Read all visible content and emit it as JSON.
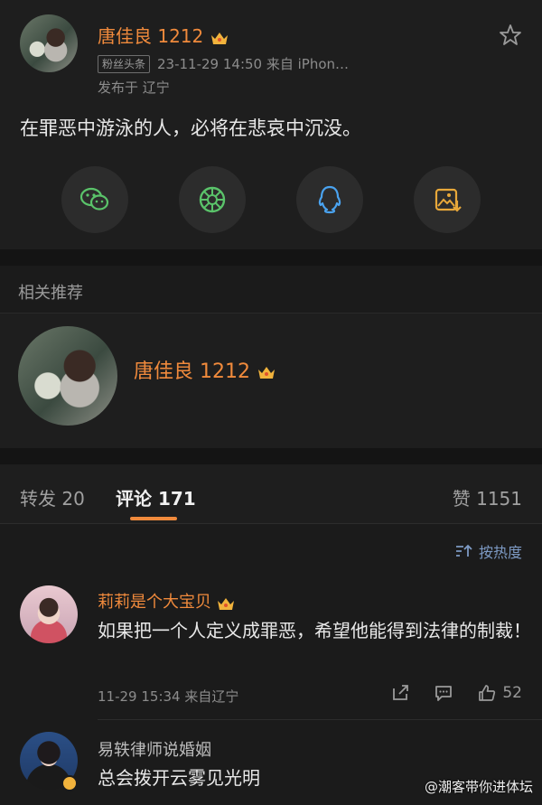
{
  "post": {
    "author": "唐佳良 1212",
    "badge": "粉丝头条",
    "time_source": "23-11-29 14:50  来自 iPhon…",
    "location": "发布于 辽宁",
    "content": "在罪恶中游泳的人，必将在悲哀中沉没。",
    "share_icons": [
      "wechat-icon",
      "moments-icon",
      "qq-icon",
      "save-image-icon"
    ]
  },
  "related": {
    "title": "相关推荐",
    "user": "唐佳良 1212"
  },
  "tabs": {
    "repost": "转发 20",
    "comments": "评论 171",
    "likes": "赞 1151"
  },
  "sort": {
    "label": "按热度"
  },
  "comments": [
    {
      "name": "莉莉是个大宝贝",
      "text": "如果把一个人定义成罪恶，希望他能得到法律的制裁！",
      "meta": "11-29 15:34  来自辽宁",
      "likes": "52"
    },
    {
      "name": "易轶律师说婚姻",
      "text": "总会拨开云雾见光明"
    }
  ],
  "watermark": "@潮客带你进体坛",
  "colors": {
    "accent": "#f08a3c",
    "background": "#1b1b1b"
  }
}
